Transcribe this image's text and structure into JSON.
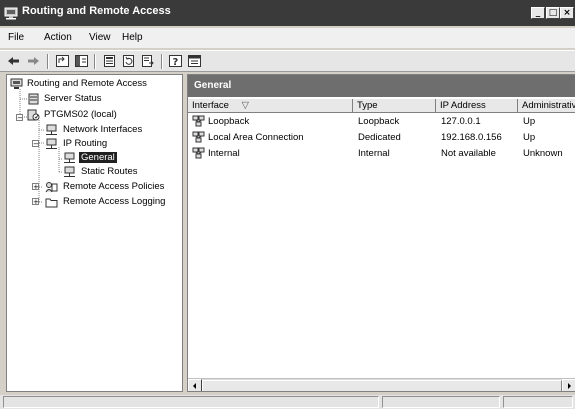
{
  "window": {
    "title": "Routing and Remote Access",
    "controls": {
      "minimize": "_",
      "maximize": "□",
      "close": "×"
    }
  },
  "menu": {
    "items": [
      {
        "label": "File"
      },
      {
        "label": "Action"
      },
      {
        "label": "View"
      },
      {
        "label": "Help"
      }
    ]
  },
  "toolbar": {
    "buttons": [
      "back-icon",
      "forward-icon",
      "up-icon",
      "show-hide-tree-icon",
      "properties-icon",
      "refresh-icon",
      "export-list-icon",
      "help-icon",
      "console-icon"
    ]
  },
  "tree": {
    "root": "Routing and Remote Access",
    "server_status": "Server Status",
    "server": "PTGMS02 (local)",
    "network_interfaces": "Network Interfaces",
    "ip_routing": "IP Routing",
    "general": "General",
    "static_routes": "Static Routes",
    "remote_access_policies": "Remote Access Policies",
    "remote_access_logging": "Remote Access Logging"
  },
  "details": {
    "header": "General",
    "columns": [
      "Interface",
      "Type",
      "IP Address",
      "Administrative"
    ],
    "sort_glyph": "▽",
    "rows": [
      {
        "interface": "Loopback",
        "type": "Loopback",
        "ip": "127.0.0.1",
        "admin": "Up"
      },
      {
        "interface": "Local Area Connection",
        "type": "Dedicated",
        "ip": "192.168.0.156",
        "admin": "Up"
      },
      {
        "interface": "Internal",
        "type": "Internal",
        "ip": "Not available",
        "admin": "Unknown"
      }
    ]
  },
  "colors": {
    "titlebar": "#3a3a3a",
    "header": "#6e6e6e",
    "selection": "#202020"
  }
}
